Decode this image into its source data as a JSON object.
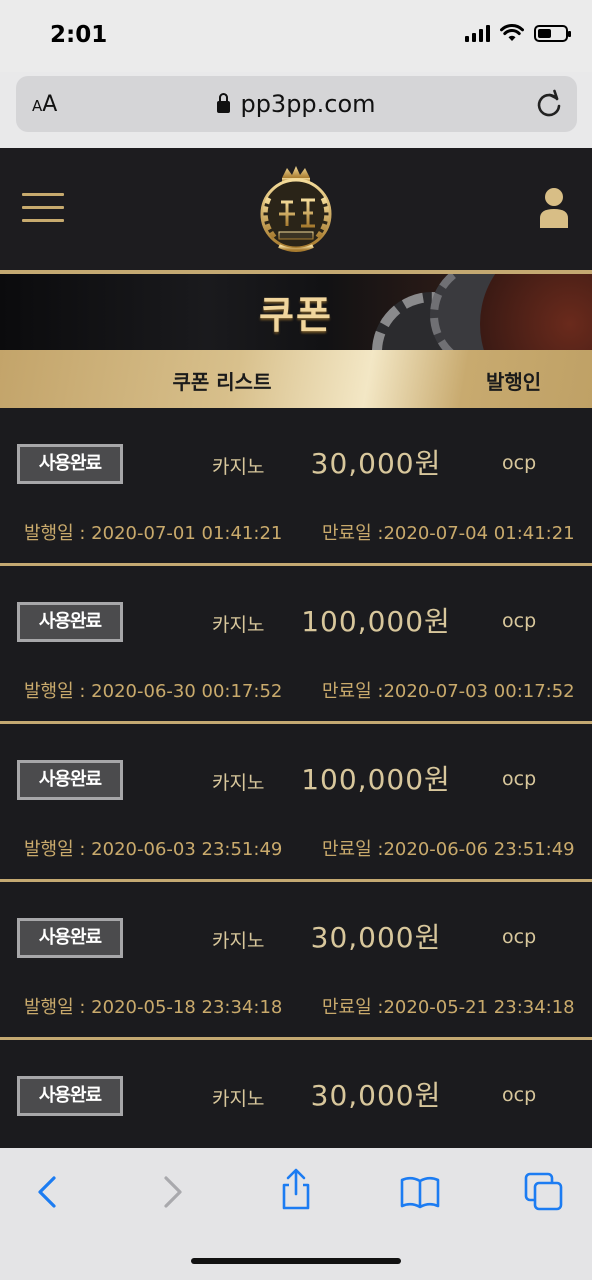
{
  "status_bar": {
    "time": "2:01"
  },
  "browser": {
    "text_size_label_small": "A",
    "text_size_label_large": "A",
    "url": "pp3pp.com"
  },
  "banner": {
    "title": "쿠폰"
  },
  "list_header": {
    "list_label": "쿠폰 리스트",
    "issuer_label": "발행인"
  },
  "coupons": [
    {
      "status": "사용완료",
      "game": "카지노",
      "amount": "30,000원",
      "issuer": "ocp",
      "issued": "발행일 : 2020-07-01 01:41:21",
      "expires": "만료일 :2020-07-04 01:41:21"
    },
    {
      "status": "사용완료",
      "game": "카지노",
      "amount": "100,000원",
      "issuer": "ocp",
      "issued": "발행일 : 2020-06-30 00:17:52",
      "expires": "만료일 :2020-07-03 00:17:52"
    },
    {
      "status": "사용완료",
      "game": "카지노",
      "amount": "100,000원",
      "issuer": "ocp",
      "issued": "발행일 : 2020-06-03 23:51:49",
      "expires": "만료일 :2020-06-06 23:51:49"
    },
    {
      "status": "사용완료",
      "game": "카지노",
      "amount": "30,000원",
      "issuer": "ocp",
      "issued": "발행일 : 2020-05-18 23:34:18",
      "expires": "만료일 :2020-05-21 23:34:18"
    },
    {
      "status": "사용완료",
      "game": "카지노",
      "amount": "30,000원",
      "issuer": "ocp",
      "issued": "",
      "expires": ""
    }
  ],
  "icons": {
    "menu": "hamburger-menu-icon",
    "logo": "casino-crown-laurel-logo",
    "user": "user-icon",
    "back": "chevron-left-icon",
    "forward": "chevron-right-icon",
    "share": "share-icon",
    "bookmarks": "book-icon",
    "tabs": "tabs-icon"
  },
  "colors": {
    "gold": "#c4a972",
    "dark_bg": "#1b1b1e",
    "ios_blue": "#1c7cf2"
  }
}
